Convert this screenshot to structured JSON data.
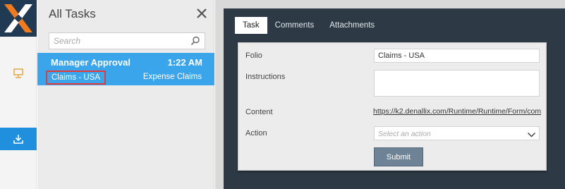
{
  "task_list": {
    "title": "All Tasks",
    "search_placeholder": "Search",
    "items": [
      {
        "name": "Manager Approval",
        "time": "1:22 AM",
        "folio": "Claims - USA",
        "process": "Expense Claims"
      }
    ]
  },
  "tabs": [
    "Task",
    "Comments",
    "Attachments"
  ],
  "form": {
    "folio_label": "Folio",
    "folio_value": "Claims - USA",
    "instructions_label": "Instructions",
    "content_label": "Content",
    "content_link": "https://k2.denallix.com/Runtime/Runtime/Form/com",
    "action_label": "Action",
    "action_placeholder": "Select an action",
    "submit_label": "Submit"
  },
  "colors": {
    "logo_orange": "#f07a1e",
    "logo_bg": "#213a54",
    "accent_blue": "#3aa5ea",
    "highlight_red": "#e63939",
    "dark_panel": "#2d3a45"
  }
}
